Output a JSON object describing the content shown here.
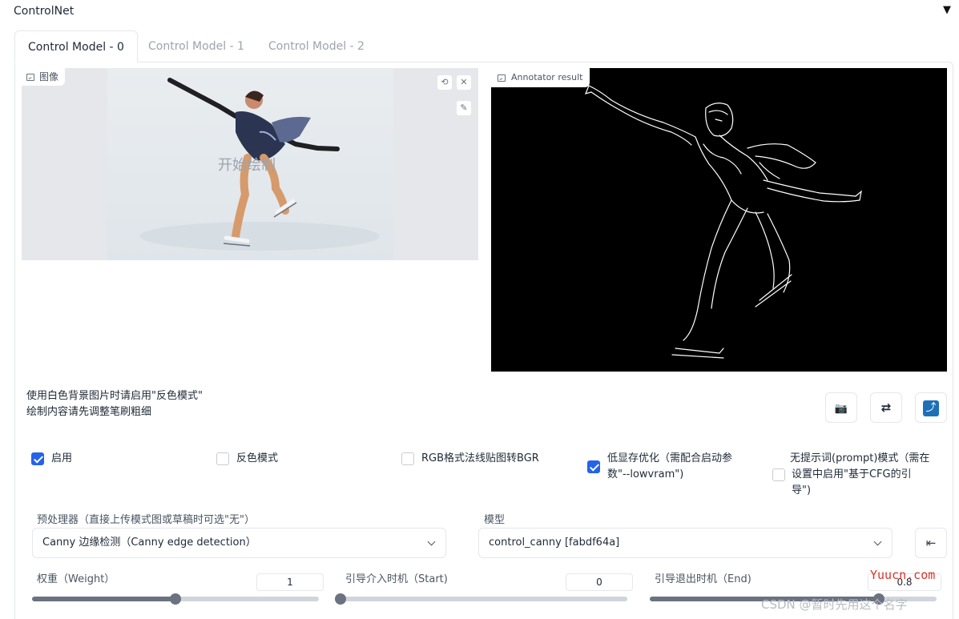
{
  "accordion": {
    "title": "ControlNet",
    "toggle": "▼"
  },
  "tabs": [
    {
      "label": "Control Model - 0"
    },
    {
      "label": "Control Model - 1"
    },
    {
      "label": "Control Model - 2"
    }
  ],
  "image_panel": {
    "label": "图像",
    "draw_hint": "开始绘制",
    "undo": "⟲",
    "clear": "✕",
    "brush": "✎"
  },
  "result_panel": {
    "label": "Annotator result"
  },
  "hints": {
    "line1": "使用白色背景图片时请启用\"反色模式\"",
    "line2": "绘制内容请先调整笔刷粗细"
  },
  "buttons": {
    "camera": "📷",
    "swap": "⇄",
    "send": "⤴",
    "send_model": "⇤"
  },
  "checkboxes": [
    {
      "label": "启用",
      "checked": true
    },
    {
      "label": "反色模式",
      "checked": false
    },
    {
      "label": "RGB格式法线贴图转BGR",
      "checked": false
    },
    {
      "label_line1": "低显存优化（需配合启动参",
      "label_line2": "数\"--lowvram\")",
      "checked": true
    },
    {
      "label_line1": "无提示词(prompt)模式（需在",
      "label_line2": "设置中启用\"基于CFG的引",
      "label_line3": "导\")",
      "checked": false
    }
  ],
  "preprocessor": {
    "label": "预处理器（直接上传模式图或草稿时可选\"无\"）",
    "value": "Canny 边缘检测（Canny edge detection）"
  },
  "model": {
    "label": "模型",
    "value": "control_canny [fabdf64a]"
  },
  "sliders": [
    {
      "label": "权重（Weight）",
      "value": "1",
      "fraction": 0.5
    },
    {
      "label": "引导介入时机（Start)",
      "value": "0",
      "fraction": 0.0
    },
    {
      "label": "引导退出时机（End)",
      "value": "0.8",
      "fraction": 0.8
    }
  ],
  "watermarks": {
    "site": "Yuucn.com",
    "csdn": "CSDN @暂时先用这个名字"
  }
}
